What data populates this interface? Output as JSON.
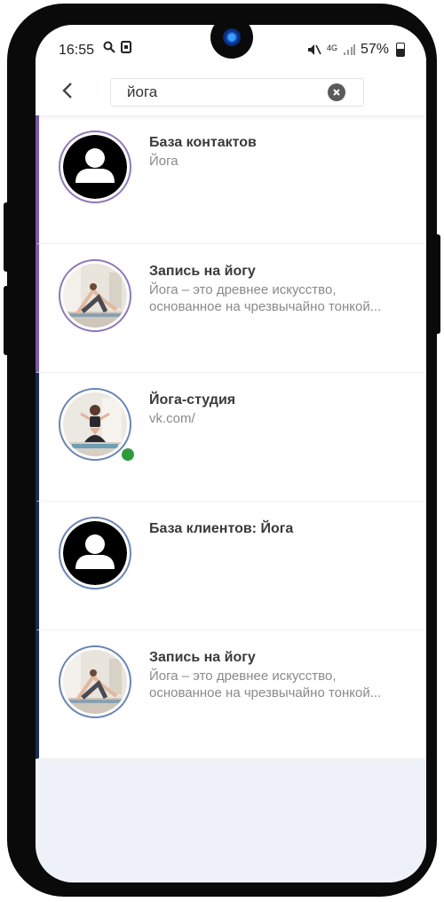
{
  "status_bar": {
    "time": "16:55",
    "network": "4G",
    "battery": "57%"
  },
  "search": {
    "value": "йога"
  },
  "results": [
    {
      "title": "База контактов",
      "line1": "Йога",
      "line2": "",
      "avatar": "user-placeholder",
      "accent": "#7a5aa8"
    },
    {
      "title": "Запись на йогу",
      "line1": "Йога – это древнее искусство,",
      "line2": "основанное на чрезвычайно тонкой...",
      "avatar": "yoga-photo",
      "accent": "#7a5aa8"
    },
    {
      "title": "Йога-студия",
      "line1": "vk.com/",
      "line2": "",
      "avatar": "yoga-photo",
      "accent": "#1b2a52",
      "online": true
    },
    {
      "title": "База клиентов: Йога",
      "line1": "",
      "line2": "",
      "avatar": "user-placeholder",
      "accent": "#1b2a52"
    },
    {
      "title": "Запись на йогу",
      "line1": "Йога – это древнее искусство,",
      "line2": "основанное на чрезвычайно тонкой...",
      "avatar": "yoga-photo",
      "accent": "#1b2a52"
    }
  ],
  "colors": {
    "purple_accent": "#7a5aa8",
    "navy_accent": "#1b2a52",
    "online": "#2e9b3c"
  }
}
